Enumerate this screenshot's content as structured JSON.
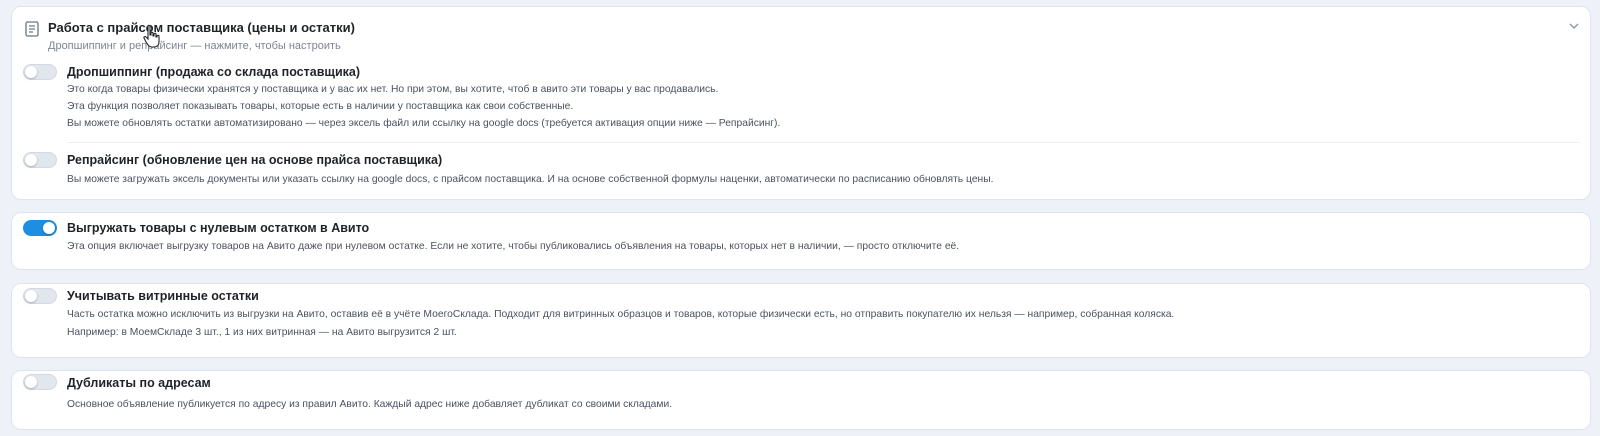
{
  "supplier_section": {
    "title": "Работа с прайсом поставщика (цены и остатки)",
    "subtitle": "Дропшиппинг и репрайсинг — нажмите, чтобы настроить",
    "icons": {
      "header": "document-icon",
      "collapse": "chevron-down-icon",
      "cursor": "hand-pointer-cursor"
    },
    "dropshipping": {
      "enabled": false,
      "title": "Дропшиппинг (продажа со склада поставщика)",
      "lines": [
        "Это когда товары физически хранятся у поставщика и у вас их нет. Но при этом, вы хотите, чтоб в авито эти товары у вас продавались.",
        "Эта функция позволяет показывать товары, которые есть в наличии у поставщика как свои собственные.",
        "Вы можете обновлять остатки автоматизировано — через эксель файл или ссылку на google docs (требуется активация опции ниже — Репрайсинг)."
      ]
    },
    "repricing": {
      "enabled": false,
      "title": "Репрайсинг (обновление цен на основе прайса поставщика)",
      "lines": [
        "Вы можете загружать эксель документы или указать ссылку на google docs, с прайсом поставщика. И на основе собственной формулы наценки, автоматически по расписанию обновлять цены."
      ]
    }
  },
  "zero_stock": {
    "enabled": true,
    "title": "Выгружать товары с нулевым остатком в Авито",
    "lines": [
      "Эта опция включает выгрузку товаров на Авито даже при нулевом остатке. Если не хотите, чтобы публиковались объявления на товары, которых нет в наличии, — просто отключите её."
    ]
  },
  "showcase_stock": {
    "enabled": false,
    "title": "Учитывать витринные остатки",
    "lines": [
      "Часть остатка можно исключить из выгрузки на Авито, оставив её в учёте МоегоСклада. Подходит для витринных образцов и товаров, которые физически есть, но отправить покупателю их нельзя — например, собранная коляска.",
      "Например: в МоемСкладе 3 шт., 1 из них витринная — на Авито выгрузится 2 шт."
    ]
  },
  "address_duplicates": {
    "enabled": false,
    "title": "Дубликаты по адресам",
    "lines": [
      "Основное объявление публикуется по адресу из правил Авито. Каждый адрес ниже добавляет дубликат со своими складами."
    ]
  },
  "colors": {
    "toggle_on": "#1d8ee2",
    "toggle_off": "#e2e7ee",
    "card_bg": "#ffffff",
    "page_bg": "#eef2f8"
  }
}
